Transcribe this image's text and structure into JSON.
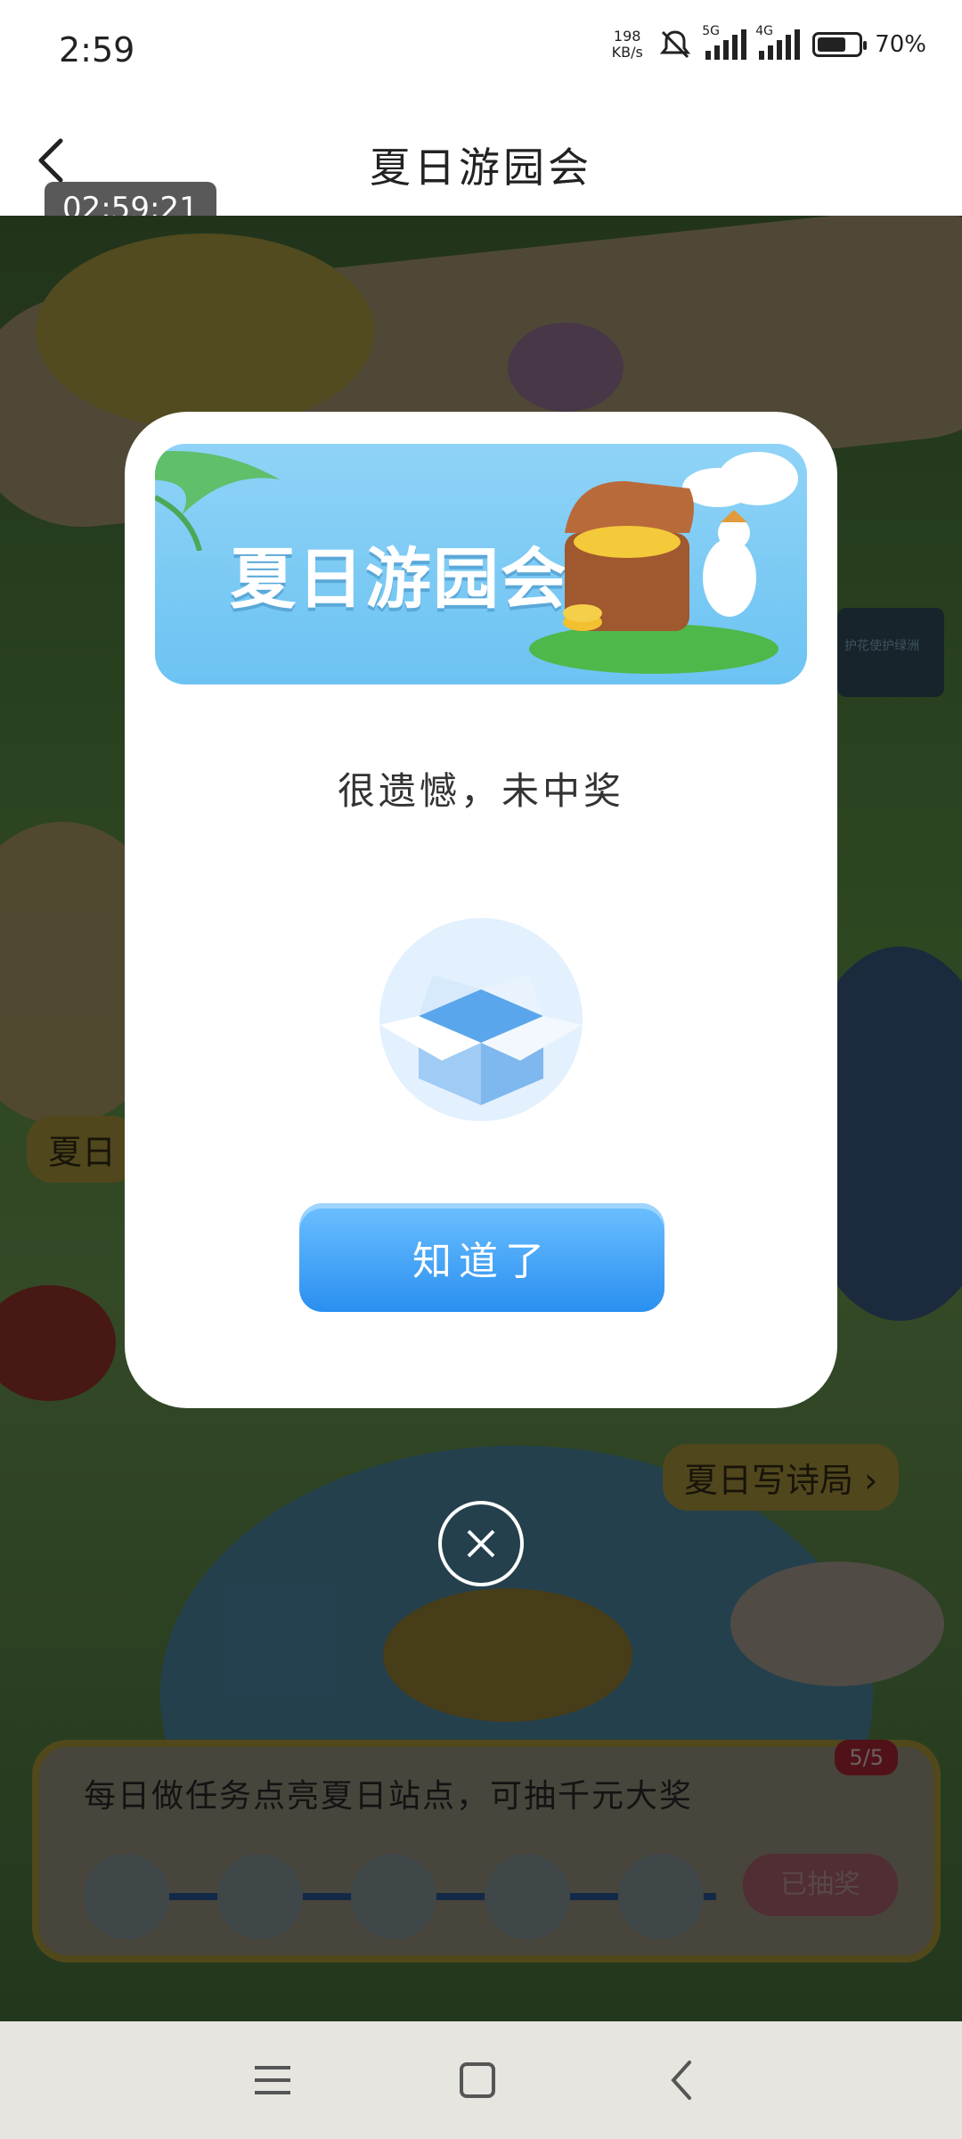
{
  "status_bar": {
    "time": "2:59",
    "net_speed_value": "198",
    "net_speed_unit": "KB/s",
    "sim1_label": "5G",
    "sim2_label": "4G",
    "battery_percent": "70%",
    "battery_level": 0.7
  },
  "header": {
    "title": "夏日游园会",
    "timestamp": "02:59:21"
  },
  "background": {
    "station_right_1": "护花使护绿洲",
    "station_left": "夏日",
    "poem_link": "夏日写诗局",
    "panel_text": "每日做任务点亮夏日站点，可抽千元大奖",
    "panel_badge": "5/5",
    "panel_button": "已抽奖"
  },
  "modal": {
    "banner_title": "夏日游园会",
    "result_text": "很遗憾，未中奖",
    "ok_label": "知道了"
  },
  "colors": {
    "accent": "#2a8ff0",
    "banner_bg": "#8fd3f7"
  },
  "icons": [
    "back-icon",
    "close-icon",
    "menu-icon",
    "home-icon",
    "nav-back-icon",
    "mute-icon"
  ]
}
